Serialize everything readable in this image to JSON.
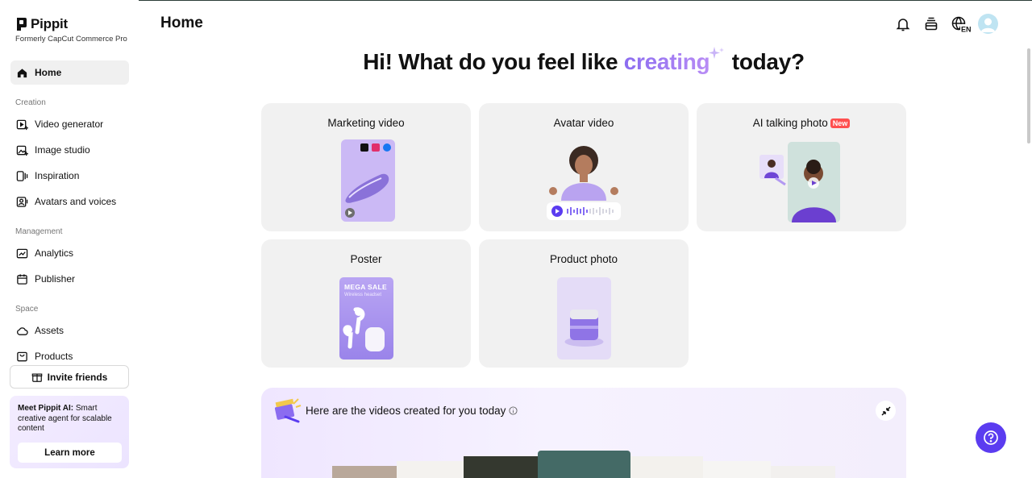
{
  "app": {
    "name": "Pippit",
    "subtitle": "Formerly CapCut Commerce Pro"
  },
  "header": {
    "title": "Home",
    "language": "EN",
    "icons": [
      "bell-icon",
      "layers-icon",
      "globe-icon",
      "avatar"
    ]
  },
  "sidebar": {
    "home_label": "Home",
    "sections": [
      {
        "label": "Creation",
        "items": [
          "Video generator",
          "Image studio",
          "Inspiration",
          "Avatars and voices"
        ]
      },
      {
        "label": "Management",
        "items": [
          "Analytics",
          "Publisher"
        ]
      },
      {
        "label": "Space",
        "items": [
          "Assets",
          "Products"
        ]
      }
    ],
    "invite_label": "Invite friends",
    "promo": {
      "bold": "Meet Pippit AI:",
      "text": " Smart creative agent for scalable content",
      "button": "Learn more"
    }
  },
  "main": {
    "headline_pre": "Hi! What do you feel like ",
    "headline_accent": "creating",
    "headline_post": " today?",
    "cards": [
      {
        "title": "Marketing video"
      },
      {
        "title": "Avatar video"
      },
      {
        "title": "AI talking photo",
        "badge": "New"
      },
      {
        "title": "Poster",
        "poster_title": "MEGA SALE",
        "poster_sub": "Wireless headset"
      },
      {
        "title": "Product photo"
      }
    ],
    "banner_text": "Here are the videos created for you today"
  },
  "colors": {
    "accent": "#8b6cf0",
    "help_button": "#5b3cf0",
    "badge_new": "#ff4f4f",
    "card_bg": "#f1f1f1"
  }
}
